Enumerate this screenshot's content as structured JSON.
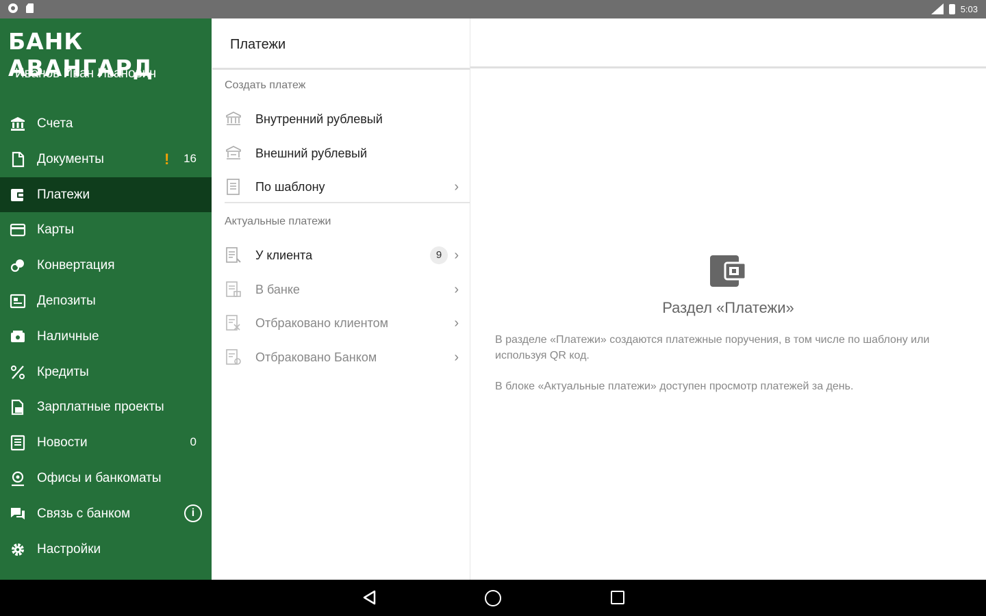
{
  "statusbar": {
    "time": "5:03"
  },
  "sidebar": {
    "brand": "БАНК АВАНГАРД",
    "user": "Иванов Иван Иванович",
    "items": [
      {
        "label": "Счета",
        "icon": "bank-icon"
      },
      {
        "label": "Документы",
        "icon": "document-icon",
        "warn": "!",
        "badge": "16"
      },
      {
        "label": "Платежи",
        "icon": "wallet-icon",
        "active": true
      },
      {
        "label": "Карты",
        "icon": "card-icon"
      },
      {
        "label": "Конвертация",
        "icon": "exchange-icon"
      },
      {
        "label": "Депозиты",
        "icon": "deposit-icon"
      },
      {
        "label": "Наличные",
        "icon": "cash-icon"
      },
      {
        "label": "Кредиты",
        "icon": "percent-icon"
      },
      {
        "label": "Зарплатные проекты",
        "icon": "payroll-icon"
      },
      {
        "label": "Новости",
        "icon": "news-icon",
        "badge": "0"
      },
      {
        "label": "Офисы и банкоматы",
        "icon": "location-icon"
      },
      {
        "label": "Связь с банком",
        "icon": "chat-icon",
        "info": "i"
      },
      {
        "label": "Настройки",
        "icon": "gear-icon"
      }
    ]
  },
  "panel": {
    "title": "Платежи",
    "create_section": "Создать платеж",
    "create_items": [
      {
        "label": "Внутренний рублевый"
      },
      {
        "label": "Внешний рублевый"
      },
      {
        "label": "По шаблону"
      }
    ],
    "actual_section": "Актуальные платежи",
    "actual_items": [
      {
        "label": "У клиента",
        "count": "9"
      },
      {
        "label": "В банке"
      },
      {
        "label": "Отбраковано клиентом"
      },
      {
        "label": "Отбраковано Банком"
      }
    ]
  },
  "detail": {
    "title": "Раздел «Платежи»",
    "text1": "В разделе «Платежи» создаются платежные поручения, в том числе по шаблону или используя QR код.",
    "text2": "В блоке «Актуальные платежи» доступен просмотр платежей за день."
  },
  "colors": {
    "sidebar": "#25703a",
    "active": "#0f3d1c",
    "warn": "#f2a007"
  }
}
